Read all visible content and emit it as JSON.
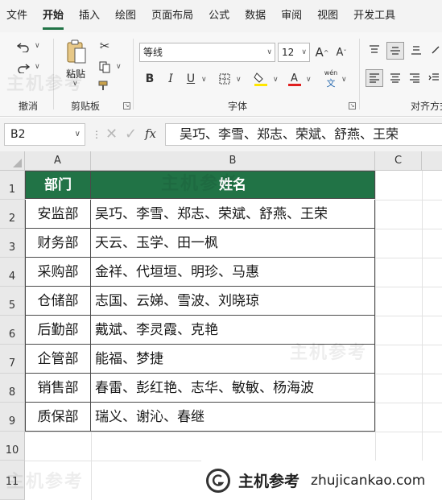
{
  "menu": [
    "文件",
    "开始",
    "插入",
    "绘图",
    "页面布局",
    "公式",
    "数据",
    "审阅",
    "视图",
    "开发工具"
  ],
  "ribbon": {
    "undo_group": "撤消",
    "paste_label": "粘贴",
    "clipboard_group": "剪贴板",
    "font_name": "等线",
    "font_size": "12",
    "font_group": "字体",
    "align_group": "对齐方式",
    "bold": "B",
    "italic": "I",
    "underline": "U",
    "phonetic": "wén"
  },
  "formula_bar": {
    "name_box": "B2",
    "fx": "fx",
    "content": "吴巧、李雪、郑志、荣斌、舒燕、王荣"
  },
  "columns": [
    "A",
    "B",
    "C"
  ],
  "row_numbers": [
    "1",
    "2",
    "3",
    "4",
    "5",
    "6",
    "7",
    "8",
    "9",
    "10",
    "11"
  ],
  "table": {
    "header": [
      "部门",
      "姓名"
    ],
    "rows": [
      [
        "安监部",
        "吴巧、李雪、郑志、荣斌、舒燕、王荣"
      ],
      [
        "财务部",
        "天云、玉学、田一枫"
      ],
      [
        "采购部",
        "金祥、代垣垣、明珍、马惠"
      ],
      [
        "仓储部",
        "志国、云娣、雪波、刘晓琼"
      ],
      [
        "后勤部",
        "戴斌、李灵霞、克艳"
      ],
      [
        "企管部",
        "能福、梦捷"
      ],
      [
        "销售部",
        "春雷、彭红艳、志华、敏敏、杨海波"
      ],
      [
        "质保部",
        "瑞义、谢沁、春继"
      ]
    ]
  },
  "watermark": {
    "brand": "主机参考",
    "url": "zhujicankao.com",
    "faint": "主机参考"
  },
  "colors": {
    "header_fill": "#217346",
    "header_text": "#ffffff"
  }
}
